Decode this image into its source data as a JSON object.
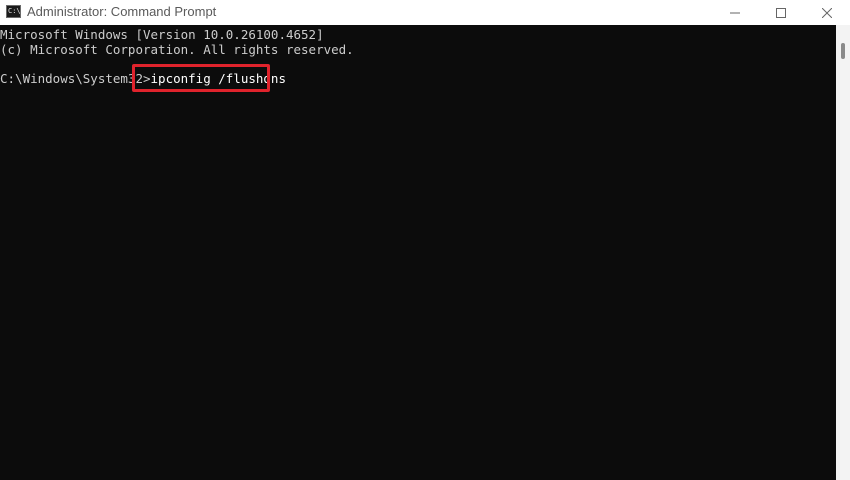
{
  "window": {
    "title": "Administrator: Command Prompt",
    "icon": "cmd-app-icon",
    "icon_glyph": "C:\\",
    "controls": [
      "minimize-icon",
      "maximize-icon",
      "close-icon"
    ]
  },
  "console": {
    "lines": [
      "Microsoft Windows [Version 10.0.26100.4652]",
      "(c) Microsoft Corporation. All rights reserved."
    ],
    "prompt": "C:\\Windows\\System32>",
    "command": "ipconfig /flushdns"
  },
  "colors": {
    "console_bg": "#0c0c0c",
    "console_text": "#cccccc",
    "highlight": "#e0232c",
    "titlebar_bg": "#ffffff"
  }
}
